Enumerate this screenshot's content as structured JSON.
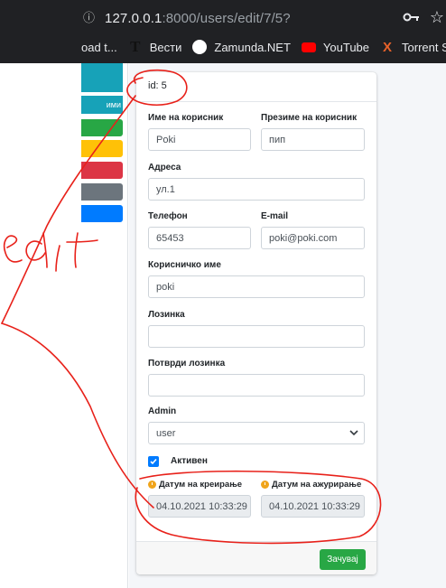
{
  "browser": {
    "url_host": "127.0.0.1",
    "url_rest": ":8000/users/edit/7/5?",
    "bookmarks": [
      {
        "label": "oad t...",
        "icon": "page-icon"
      },
      {
        "label": "Вести",
        "icon": "vesti-icon"
      },
      {
        "label": "Zamunda.NET",
        "icon": "zamunda-icon"
      },
      {
        "label": "YouTube",
        "icon": "youtube-icon"
      },
      {
        "label": "Torrent Sea",
        "icon": "torrent-icon"
      }
    ]
  },
  "sidebar": {
    "partial_label": "ими",
    "buttons": [
      {
        "color": "#28a745"
      },
      {
        "color": "#ffc107"
      },
      {
        "color": "#dc3545"
      },
      {
        "color": "#6c757d"
      },
      {
        "color": "#007bff"
      }
    ]
  },
  "card": {
    "header": "id: 5",
    "firstname_label": "Име на корисник",
    "firstname_value": "Poki",
    "lastname_label": "Презиме на корисник",
    "lastname_value": "пип",
    "address_label": "Адреса",
    "address_value": "ул.1",
    "phone_label": "Телефон",
    "phone_value": "65453",
    "email_label": "E-mail",
    "email_value": "poki@poki.com",
    "username_label": "Корисничко име",
    "username_value": "poki",
    "password_label": "Лозинка",
    "password_value": "",
    "confirm_label": "Потврди лозинка",
    "confirm_value": "",
    "admin_label": "Admin",
    "admin_value": "user",
    "active_label": "Активен",
    "active_checked": true,
    "created_label": "Датум на креирање",
    "created_value": "04.10.2021  10:33:29",
    "updated_label": "Датум на ажурирање",
    "updated_value": "04.10.2021  10:33:29",
    "save_label": "Зачувај"
  },
  "colors": {
    "annotation": "#e8211a",
    "save_button": "#28a745",
    "checkbox": "#007bff"
  },
  "annotation_text": "edit"
}
